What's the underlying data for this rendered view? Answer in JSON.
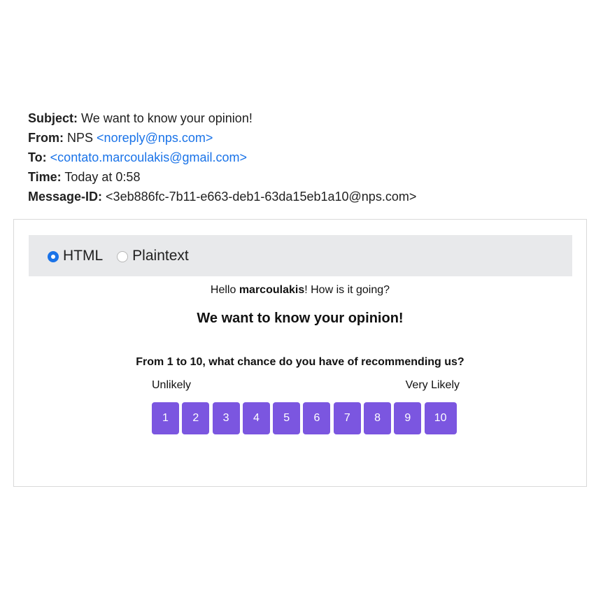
{
  "headers": {
    "subject_label": "Subject:",
    "subject_value": "We want to know your opinion!",
    "from_label": "From:",
    "from_name": "NPS",
    "from_email": "<noreply@nps.com>",
    "to_label": "To:",
    "to_email": "<contato.marcoulakis@gmail.com>",
    "time_label": "Time:",
    "time_value": "Today at 0:58",
    "message_id_label": "Message-ID:",
    "message_id_value": "<3eb886fc-7b11-e663-deb1-63da15eb1a10@nps.com>"
  },
  "view_mode": {
    "options": [
      {
        "label": "HTML",
        "selected": true
      },
      {
        "label": "Plaintext",
        "selected": false
      }
    ]
  },
  "email": {
    "greeting_prefix": "Hello ",
    "greeting_name": "marcoulakis",
    "greeting_suffix": "! How is it going?",
    "title": "We want to know your opinion!",
    "question": "From 1 to 10, what chance do you have of recommending us?",
    "scale_low_label": "Unlikely",
    "scale_high_label": "Very Likely",
    "scale": [
      "1",
      "2",
      "3",
      "4",
      "5",
      "6",
      "7",
      "8",
      "9",
      "10"
    ]
  },
  "colors": {
    "link": "#1a73e8",
    "score_button": "#7b56e0",
    "mode_bar": "#e8e9eb"
  }
}
